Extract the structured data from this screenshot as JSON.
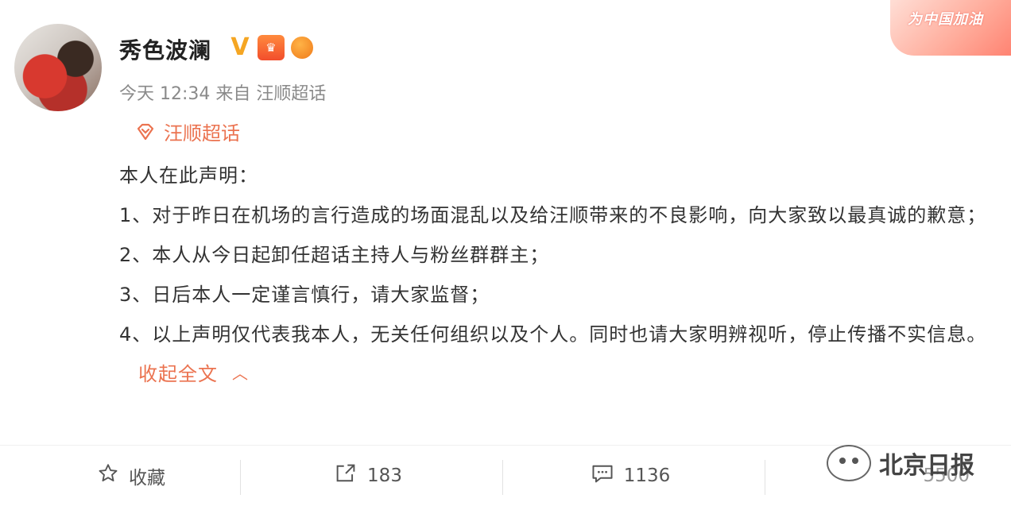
{
  "header": {
    "username": "秀色波澜",
    "verified_icon": "v-icon",
    "meta": "今天 12:34 来自 汪顺超话",
    "promo": "为中国加油"
  },
  "topic": {
    "label": "汪顺超话",
    "icon": "topic-diamond-icon"
  },
  "post": {
    "line0": "本人在此声明：",
    "line1": "1、对于昨日在机场的言行造成的场面混乱以及给汪顺带来的不良影响，向大家致以最真诚的歉意；",
    "line2": "2、本人从今日起卸任超话主持人与粉丝群群主；",
    "line3": "3、日后本人一定谨言慎行，请大家监督；",
    "line4": "4、以上声明仅代表我本人，无关任何组织以及个人。同时也请大家明辨视听，停止传播不实信息。",
    "collapse_label": "收起全文"
  },
  "actions": {
    "favorite": "收藏",
    "repost": "183",
    "comment": "1136",
    "like": "5500"
  },
  "watermark": "北京日报",
  "colors": {
    "accent": "#eb7350",
    "text": "#333333",
    "muted": "#8a8a8a"
  }
}
